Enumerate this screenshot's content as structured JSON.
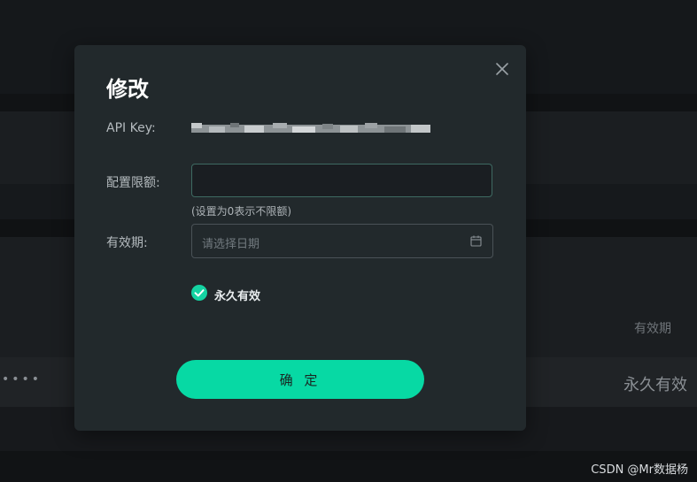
{
  "dialog": {
    "title": "修改",
    "fields": {
      "api_key_label": "API Key:",
      "quota_label": "配置限额:",
      "quota_value": "",
      "quota_hint": "(设置为0表示不限额)",
      "expiry_label": "有效期:",
      "expiry_placeholder": "请选择日期"
    },
    "permanent": {
      "label": "永久有效",
      "checked": true
    },
    "confirm_label": "确 定"
  },
  "background": {
    "expiry_header": "有效期",
    "expiry_value": "永久有效",
    "masked_key": "••••"
  },
  "watermark": "CSDN @Mr数据杨",
  "icons": {
    "close": "close-icon",
    "calendar": "calendar-icon",
    "check": "check-icon"
  },
  "colors": {
    "accent": "#07d9a4",
    "dialog_bg": "#22292c",
    "page_bg": "#141719"
  }
}
